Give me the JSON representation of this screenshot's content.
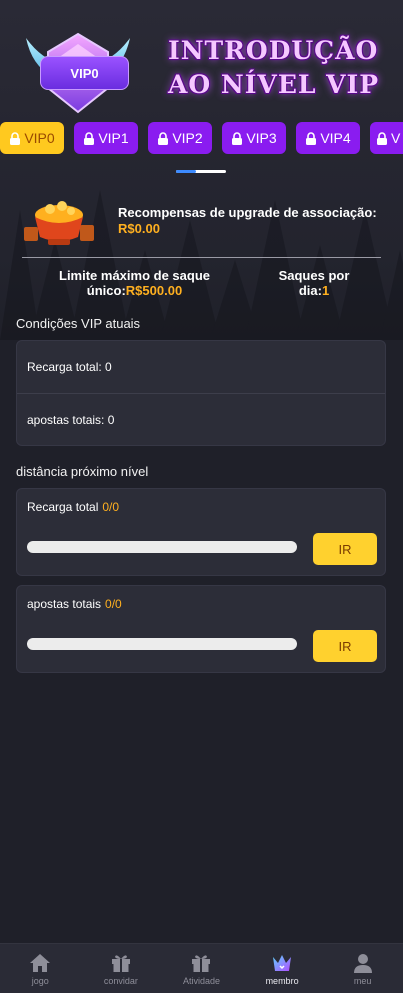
{
  "header": {
    "badge_label": "VIP0",
    "title_line1": "INTRODUÇÃO",
    "title_line2": "AO NÍVEL VIP"
  },
  "tabs": [
    {
      "label": "VIP0",
      "active": true
    },
    {
      "label": "VIP1",
      "active": false
    },
    {
      "label": "VIP2",
      "active": false
    },
    {
      "label": "VIP3",
      "active": false
    },
    {
      "label": "VIP4",
      "active": false
    },
    {
      "label": "V",
      "active": false
    }
  ],
  "reward": {
    "text": "Recompensas de upgrade de associação:",
    "value": "R$0.00"
  },
  "limits": {
    "max_withdraw_label": "Limite máximo de saque único:",
    "max_withdraw_value": "R$500.00",
    "per_day_label": "Saques por dia:",
    "per_day_value": "1"
  },
  "current_conditions": {
    "title": "Condições VIP atuais",
    "rows": [
      "Recarga total: 0",
      "apostas totais: 0"
    ]
  },
  "next_level": {
    "title": "distância próximo nível",
    "items": [
      {
        "label": "Recarga total",
        "value": "0/0",
        "progress": 0,
        "button": "IR"
      },
      {
        "label": "apostas totais",
        "value": "0/0",
        "progress": 0,
        "button": "IR"
      }
    ]
  },
  "nav": [
    {
      "label": "jogo",
      "icon": "home-icon",
      "active": false
    },
    {
      "label": "convidar",
      "icon": "gift-icon",
      "active": false
    },
    {
      "label": "Atividade",
      "icon": "gift-icon",
      "active": false
    },
    {
      "label": "membro",
      "icon": "crown-icon",
      "active": true
    },
    {
      "label": "meu",
      "icon": "user-icon",
      "active": false
    }
  ],
  "colors": {
    "background": "#1f2029",
    "accent_gold": "#ffb020",
    "tab_purple": "#8a1cf0",
    "tab_active": "#ffc91f"
  }
}
